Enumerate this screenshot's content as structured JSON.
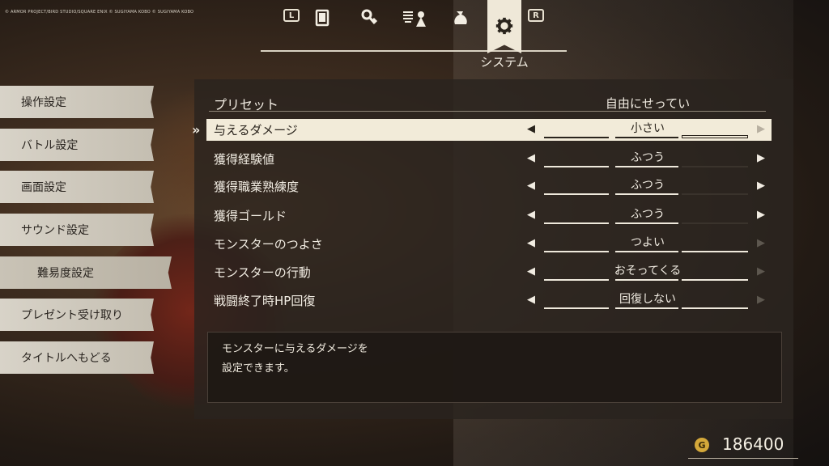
{
  "copyright": "© ARMOR PROJECT/BIRD STUDIO/SQUARE ENIX © SUGIYAMA KOBO © SUGIYAMA KOBO",
  "tabs": {
    "left_button": "L",
    "right_button": "R",
    "icons": [
      "book-icon",
      "key-icon",
      "party-icon",
      "bag-icon",
      "gear-icon"
    ],
    "active_label": "システム"
  },
  "menu": {
    "items": [
      "操作設定",
      "バトル設定",
      "画面設定",
      "サウンド設定",
      "難易度設定",
      "プレゼント受け取り",
      "タイトルへもどる"
    ],
    "selected_index": 4
  },
  "preset": {
    "label": "プリセット",
    "value": "自由にせってい"
  },
  "settings": [
    {
      "label": "与えるダメージ",
      "value": "小さい",
      "level": 1,
      "levels": 3,
      "right_enabled": false,
      "selected": true
    },
    {
      "label": "獲得経験値",
      "value": "ふつう",
      "level": 2,
      "levels": 3,
      "right_enabled": true,
      "selected": false
    },
    {
      "label": "獲得職業熟練度",
      "value": "ふつう",
      "level": 2,
      "levels": 3,
      "right_enabled": true,
      "selected": false
    },
    {
      "label": "獲得ゴールド",
      "value": "ふつう",
      "level": 2,
      "levels": 3,
      "right_enabled": true,
      "selected": false
    },
    {
      "label": "モンスターのつよさ",
      "value": "つよい",
      "level": 3,
      "levels": 3,
      "right_enabled": false,
      "selected": false
    },
    {
      "label": "モンスターの行動",
      "value": "おそってくる",
      "level": 3,
      "levels": 3,
      "right_enabled": false,
      "selected": false
    },
    {
      "label": "戦闘終了時HP回復",
      "value": "回復しない",
      "level": 3,
      "levels": 3,
      "right_enabled": false,
      "selected": false
    }
  ],
  "description": "モンスターに与えるダメージを\n設定できます。",
  "gold": {
    "icon": "G",
    "value": "186400"
  },
  "colors": {
    "panel": "#2a231e",
    "highlight": "#f2ebd9",
    "gold": "#d4a83a"
  }
}
